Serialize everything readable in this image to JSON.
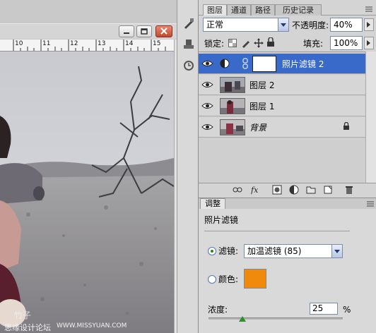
{
  "document": {
    "ruler_labels": [
      "10",
      "11",
      "12",
      "13",
      "14",
      "15"
    ],
    "watermark_top": "竹子",
    "watermark_bottom": "思缘设计论坛",
    "watermark_url": "WWW.MISSYUAN.COM"
  },
  "panel": {
    "tabs": [
      "图层",
      "通道",
      "路径",
      "历史记录"
    ],
    "active_tab": "图层",
    "blend_mode": "正常",
    "opacity_label": "不透明度:",
    "opacity_value": "40%",
    "lock_label": "锁定:",
    "fill_label": "填充:",
    "fill_value": "100%"
  },
  "layers": [
    {
      "name": "照片滤镜 2",
      "selected": true,
      "type": "adjustment"
    },
    {
      "name": "图层 2",
      "selected": false,
      "type": "image"
    },
    {
      "name": "图层 1",
      "selected": false,
      "type": "image"
    },
    {
      "name": "背景",
      "selected": false,
      "type": "background",
      "locked": true
    }
  ],
  "adjustments": {
    "tab_label": "调整",
    "title": "照片滤镜",
    "filter_label": "滤镜:",
    "filter_value": "加温滤镜 (85)",
    "color_label": "颜色:",
    "color_value": "#ef8a0c",
    "density_label": "浓度:",
    "density_value": "25",
    "density_unit": "%",
    "density_level": 0.25,
    "selected_option": "filter"
  },
  "icons": {
    "window": [
      "minimize-icon",
      "restore-icon",
      "close-icon"
    ],
    "footer": [
      "link-icon",
      "fx-icon",
      "mask-icon",
      "adjustment-layer-icon",
      "group-icon",
      "new-layer-icon",
      "trash-icon"
    ]
  },
  "colors": {
    "selection": "#3a6ac9",
    "swatch": "#ef8a0c",
    "close_button": "#c14a30"
  }
}
